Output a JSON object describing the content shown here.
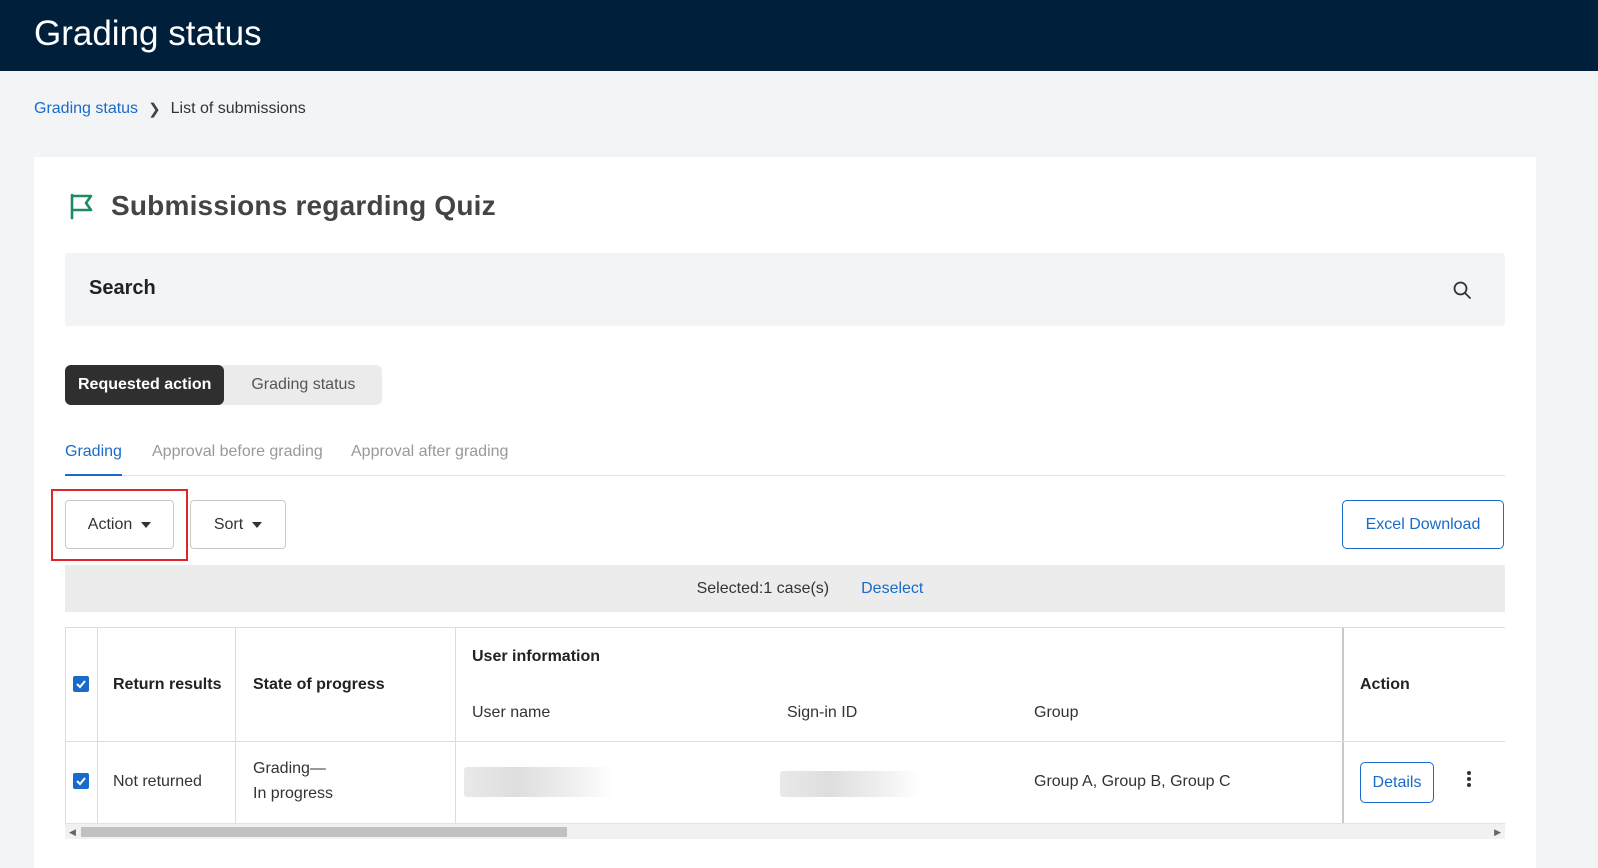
{
  "app": {
    "title": "Grading status"
  },
  "breadcrumb": {
    "parent": "Grading status",
    "current": "List of submissions"
  },
  "page": {
    "heading": "Submissions regarding Quiz",
    "heading_icon": "flag-icon",
    "accent": "#1a6bc9",
    "icon_color": "#1e8a5f"
  },
  "search": {
    "label": "Search",
    "icon": "search-icon"
  },
  "segment": {
    "active": "Requested action",
    "inactive": "Grading status"
  },
  "subtabs": [
    "Grading",
    "Approval before grading",
    "Approval after grading"
  ],
  "toolbar": {
    "action_label": "Action",
    "sort_label": "Sort",
    "excel_label": "Excel Download"
  },
  "selection": {
    "count_text": "Selected:1 case(s)",
    "deselect_label": "Deselect"
  },
  "table": {
    "headers": {
      "return_results": "Return results",
      "state": "State of progress",
      "user_info": "User information",
      "user_name": "User name",
      "sign_in_id": "Sign-in ID",
      "group": "Group",
      "action": "Action"
    },
    "rows": [
      {
        "checked": true,
        "return_results": "Not returned",
        "state_line1": "Grading—",
        "state_line2": "In progress",
        "group": "Group A, Group B, Group C",
        "details_label": "Details"
      }
    ]
  }
}
